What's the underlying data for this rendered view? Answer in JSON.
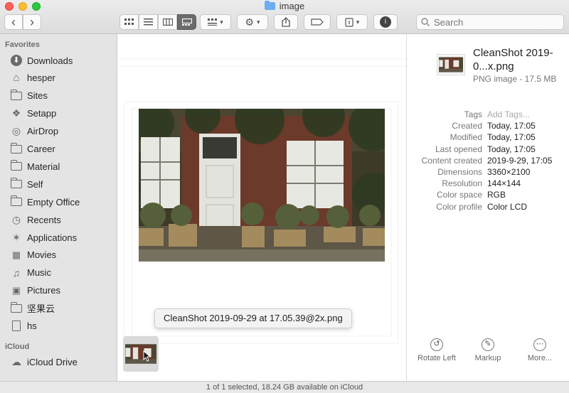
{
  "window": {
    "title": "image"
  },
  "toolbar": {
    "back_label": "‹",
    "forward_label": "›",
    "search_placeholder": "Search"
  },
  "sidebar": {
    "favorites_title": "Favorites",
    "favorites": [
      {
        "label": "Downloads",
        "icon": "downloads-icon"
      },
      {
        "label": "hesper",
        "icon": "home-icon"
      },
      {
        "label": "Sites",
        "icon": "folder-icon"
      },
      {
        "label": "Setapp",
        "icon": "setapp-icon"
      },
      {
        "label": "AirDrop",
        "icon": "airdrop-icon"
      },
      {
        "label": "Career",
        "icon": "folder-icon"
      },
      {
        "label": "Material",
        "icon": "folder-icon"
      },
      {
        "label": "Self",
        "icon": "folder-icon"
      },
      {
        "label": "Empty Office",
        "icon": "folder-icon"
      },
      {
        "label": "Recents",
        "icon": "recents-icon"
      },
      {
        "label": "Applications",
        "icon": "applications-icon"
      },
      {
        "label": "Movies",
        "icon": "movies-icon"
      },
      {
        "label": "Music",
        "icon": "music-icon"
      },
      {
        "label": "Pictures",
        "icon": "pictures-icon"
      },
      {
        "label": "坚果云",
        "icon": "folder-icon"
      },
      {
        "label": "hs",
        "icon": "file-icon"
      }
    ],
    "icloud_title": "iCloud",
    "icloud": [
      {
        "label": "iCloud Drive",
        "icon": "icloud-icon"
      }
    ]
  },
  "main": {
    "tooltip": "CleanShot 2019-09-29 at 17.05.39@2x.png"
  },
  "inspector": {
    "filename": "CleanShot 2019-0...x.png",
    "kind": "PNG image - 17.5 MB",
    "meta": [
      {
        "key": "Tags",
        "value": "Add Tags...",
        "muted": true
      },
      {
        "key": "Created",
        "value": "Today, 17:05"
      },
      {
        "key": "Modified",
        "value": "Today, 17:05"
      },
      {
        "key": "Last opened",
        "value": "Today, 17:05"
      },
      {
        "key": "Content created",
        "value": "2019-9-29, 17:05"
      },
      {
        "key": "Dimensions",
        "value": "3360×2100"
      },
      {
        "key": "Resolution",
        "value": "144×144"
      },
      {
        "key": "Color space",
        "value": "RGB"
      },
      {
        "key": "Color profile",
        "value": "Color LCD"
      }
    ],
    "actions": [
      {
        "label": "Rotate Left",
        "icon": "rotate-left-icon"
      },
      {
        "label": "Markup",
        "icon": "markup-icon"
      },
      {
        "label": "More...",
        "icon": "more-icon"
      }
    ]
  },
  "status": {
    "text": "1 of 1 selected, 18.24 GB available on iCloud"
  }
}
